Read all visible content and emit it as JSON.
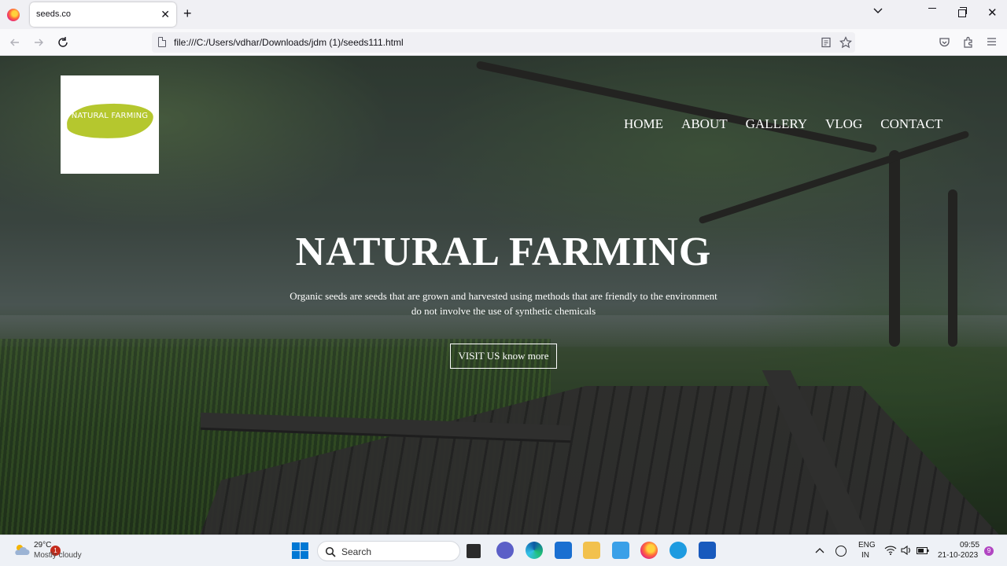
{
  "browser": {
    "tab_title": "seeds.co",
    "url": "file:///C:/Users/vdhar/Downloads/jdm (1)/seeds111.html"
  },
  "site": {
    "logo_text": "NATURAL FARMING",
    "nav": [
      {
        "label": "HOME"
      },
      {
        "label": "ABOUT"
      },
      {
        "label": "GALLERY"
      },
      {
        "label": "VLOG"
      },
      {
        "label": "CONTACT"
      }
    ],
    "hero": {
      "title": "NATURAL FARMING",
      "subtitle_line1": "Organic seeds are seeds that are grown and harvested using methods that are friendly to the environment",
      "subtitle_line2": "do not involve the use of synthetic chemicals",
      "button_label": "VISIT US know more"
    }
  },
  "taskbar": {
    "temperature": "29°C",
    "weather": "Mostly cloudy",
    "weather_badge": "1",
    "search_placeholder": "Search",
    "lang_line1": "ENG",
    "lang_line2": "IN",
    "time": "09:55",
    "date": "21-10-2023",
    "notification_count": "9"
  },
  "colors": {
    "logo_brush": "#b5c72e",
    "windows_blue": "#0078d4"
  }
}
